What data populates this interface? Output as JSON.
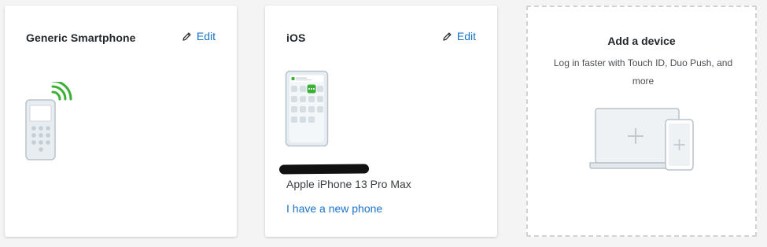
{
  "cards": {
    "generic": {
      "title": "Generic Smartphone",
      "edit_label": "Edit",
      "icons": [
        "pencil-icon",
        "smartphone-signal-icon"
      ]
    },
    "ios": {
      "title": "iOS",
      "edit_label": "Edit",
      "model": "Apple iPhone 13 Pro Max",
      "new_phone_link": "I have a new phone",
      "icons": [
        "pencil-icon",
        "iphone-icon"
      ]
    },
    "add": {
      "title": "Add a device",
      "subtitle": "Log in faster with Touch ID, Duo Push, and more",
      "icons": [
        "laptop-plus-icon",
        "tablet-plus-icon"
      ]
    }
  },
  "colors": {
    "link": "#1a73c9",
    "signal": "#3cb034",
    "device_fill": "#e8edf1",
    "device_stroke": "#b8c3cb"
  }
}
